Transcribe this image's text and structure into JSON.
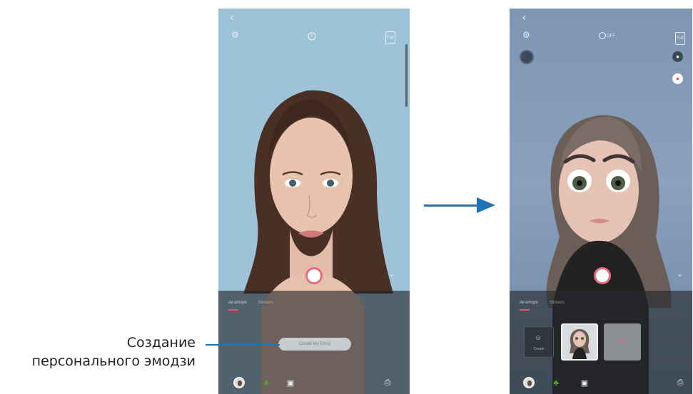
{
  "left_screen": {
    "top_bar": {
      "back_icon": "chevron-left-icon",
      "settings_icon": "gear-icon",
      "timer_icon": "timer-off-icon",
      "ratio_label": "Full"
    },
    "tabs": [
      "All emojis",
      "Stickers"
    ],
    "create_button_label": "Create My Emoji",
    "bottom_tray": [
      "emoji-face-icon",
      "sticker-icon",
      "gallery-icon",
      "share-icon"
    ]
  },
  "right_screen": {
    "top_bar": {
      "back_icon": "chevron-left-icon",
      "settings_icon": "gear-icon",
      "timer_label": "OFF",
      "ratio_label": "Full"
    },
    "tabs": [
      "All emojis",
      "Stickers"
    ],
    "cards": {
      "create_label": "Create",
      "add_label": "+"
    },
    "bottom_tray": [
      "emoji-face-icon",
      "sticker-icon",
      "gallery-icon",
      "share-icon"
    ]
  },
  "callout": {
    "line1": "Создание",
    "line2": "персонального эмодзи"
  },
  "colors": {
    "accent": "#1f74b6",
    "shutter_ring": "#e46a80",
    "tab_underline": "#e8536b"
  }
}
